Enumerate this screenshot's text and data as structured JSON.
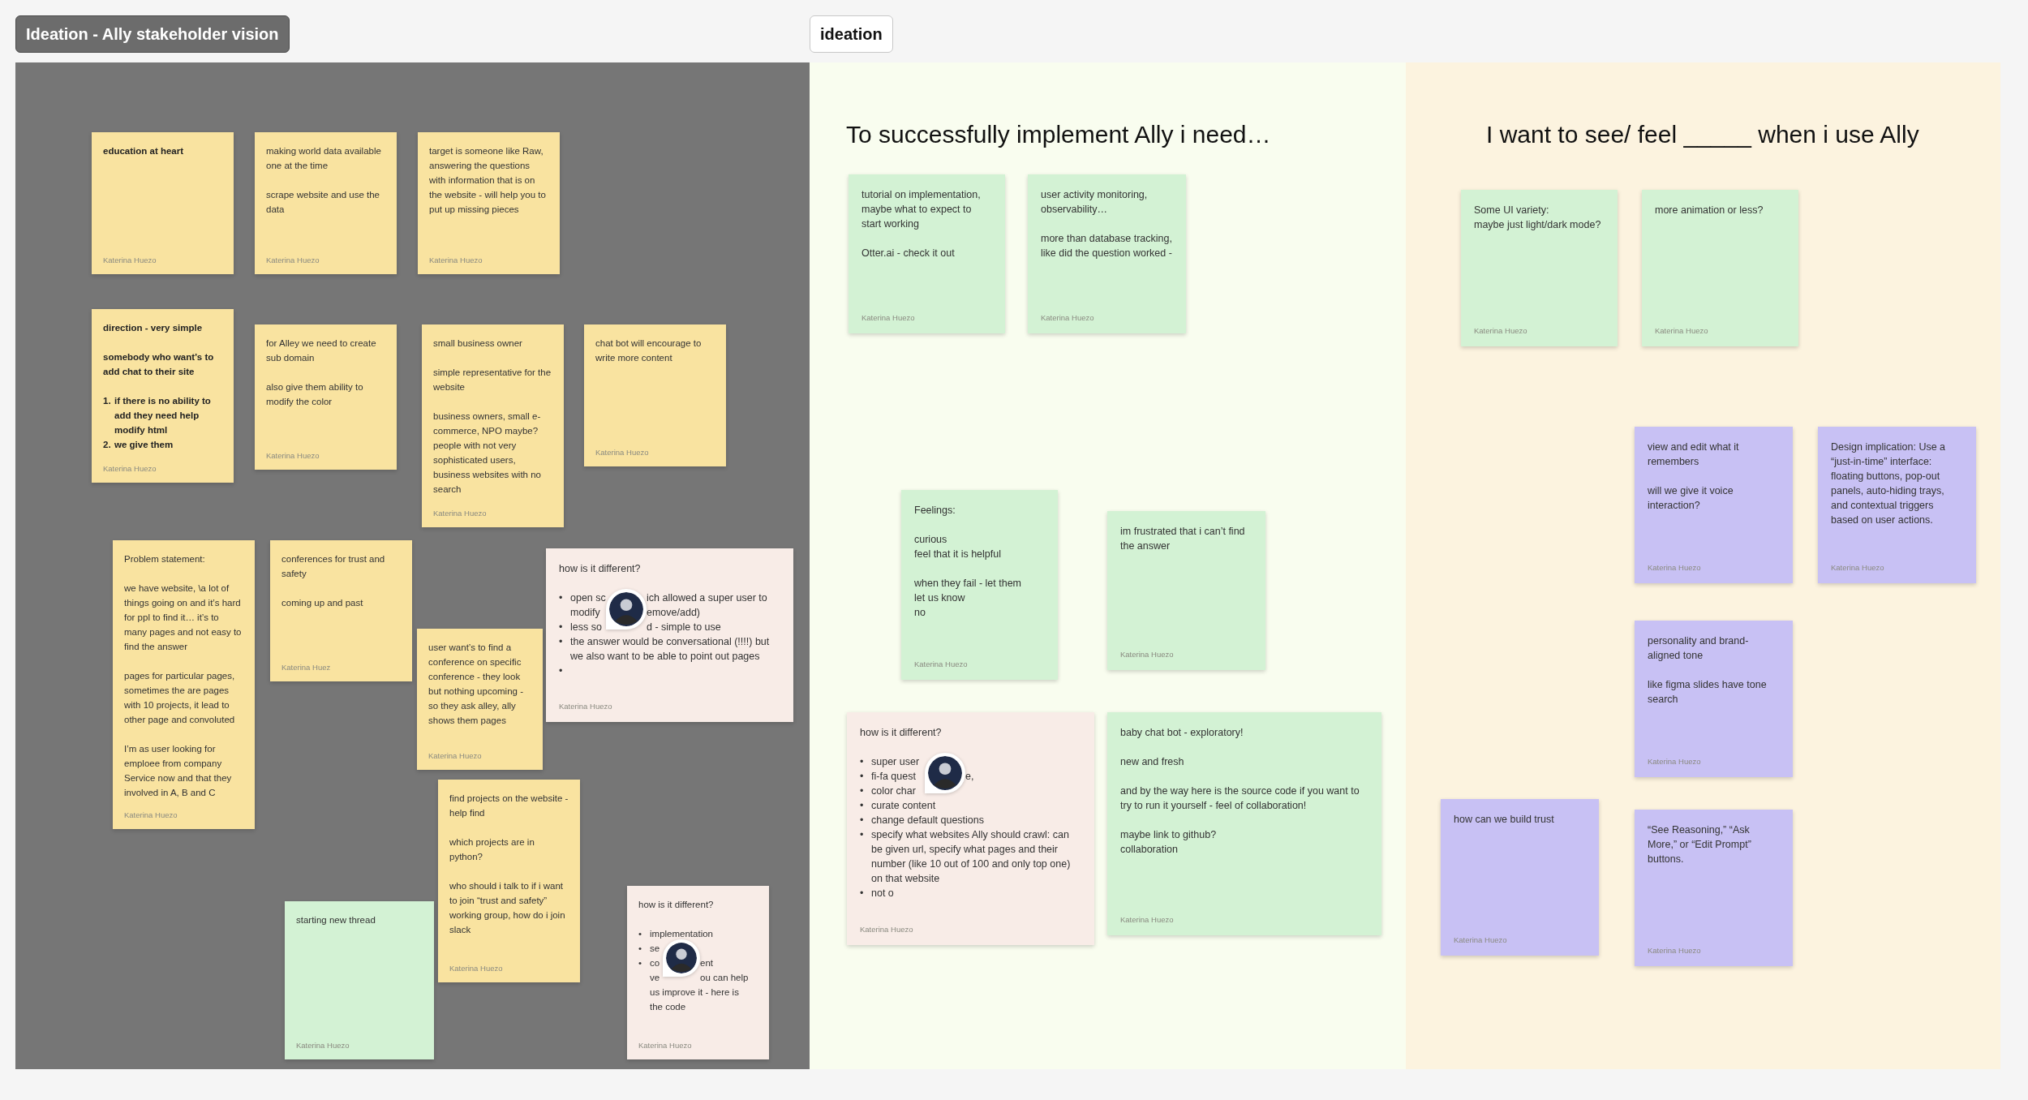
{
  "sections": [
    {
      "label": "Ideation - Ally stakeholder vision",
      "color": "#767676",
      "notes": [
        {
          "color": "#f9e3a0",
          "bold": true,
          "blocks": [
            {
              "text": "education at heart"
            }
          ],
          "author": "Katerina Huezo"
        },
        {
          "color": "#f9e3a0",
          "blocks": [
            {
              "text": "making world data available one at the time"
            },
            {
              "text": "scrape website and use the data"
            }
          ],
          "author": "Katerina Huezo"
        },
        {
          "color": "#f9e3a0",
          "blocks": [
            {
              "text": "target is someone like Raw, answering the questions with information that is on the website - will help you to put up missing pieces"
            }
          ],
          "author": "Katerina Huezo"
        },
        {
          "color": "#f9e3a0",
          "bold": true,
          "blocks": [
            {
              "text": "direction - very simple"
            },
            {
              "text": "somebody who want’s to add chat to their site"
            },
            {
              "marker": "1.",
              "text": "if there is no ability to add they need help modify html"
            },
            {
              "marker": "2.",
              "text": "we give them"
            }
          ],
          "author": "Katerina Huezo"
        },
        {
          "color": "#f9e3a0",
          "blocks": [
            {
              "text": "for Alley we need to create sub domain"
            },
            {
              "text": "also give them ability to modify the color"
            }
          ],
          "author": "Katerina Huezo"
        },
        {
          "color": "#f9e3a0",
          "blocks": [
            {
              "text": "small business owner"
            },
            {
              "text": "simple representative for the website"
            },
            {
              "text": "business owners, small e-commerce, NPO maybe? people with not very sophisticated users, business websites with no search"
            }
          ],
          "author": "Katerina Huezo"
        },
        {
          "color": "#f9e3a0",
          "blocks": [
            {
              "text": "chat bot will encourage to write more content"
            }
          ],
          "author": "Katerina Huezo"
        },
        {
          "color": "#f9e3a0",
          "blocks": [
            {
              "text": "Problem statement:"
            },
            {
              "text": "we have website, \\a lot of things going on and it’s hard for ppl to find it… it’s to many pages and not easy to find the answer"
            },
            {
              "text": "pages for particular pages, sometimes the are pages with 10 projects, it lead to other page and convoluted"
            },
            {
              "text": "I’m as user looking for emploee from company Service now and that they involved in A, B and C"
            }
          ],
          "author": "Katerina Huezo"
        },
        {
          "color": "#f9e3a0",
          "blocks": [
            {
              "text": "conferences for trust and safety"
            },
            {
              "text": "coming up and past"
            }
          ],
          "author": "Katerina Huez"
        },
        {
          "color": "#f9e3a0",
          "blocks": [
            {
              "text": "user want’s to find a conference on specific conference - they look but nothing upcoming - so they ask alley, ally shows them pages"
            }
          ],
          "author": "Katerina Huezo"
        },
        {
          "color": "#f9e3a0",
          "blocks": [
            {
              "text": "find projects on the website - help find"
            },
            {
              "text": "which projects are in python?"
            },
            {
              "text": "who should i talk to if i want to join “trust and safety” working group, how do i join slack"
            }
          ],
          "author": "Katerina Huezo"
        },
        {
          "color": "#f8ece7",
          "blocks": [
            {
              "text": "how is it different?"
            },
            {
              "marker": "•",
              "covered": true,
              "avatar": true,
              "text": "open sc",
              "after": "ich allowed a super user to"
            },
            {
              "covered": true,
              "text": "modify",
              "after": "emove/add)"
            },
            {
              "marker": "•",
              "covered": true,
              "text": "less so",
              "after": "d - simple to use"
            },
            {
              "marker": "•",
              "covered": false,
              "text": "the answer would be conversational (!!!!) but we also want to be able to point out pages"
            },
            {
              "marker": "•"
            }
          ],
          "author": "Katerina Huezo"
        },
        {
          "color": "#d3f2d4",
          "blocks": [
            {
              "text": "starting new thread"
            }
          ],
          "author": "Katerina Huezo"
        },
        {
          "color": "#f8ece7",
          "blocks": [
            {
              "text": "how is it different?"
            },
            {
              "marker": "•",
              "covered": false,
              "text": "implementation"
            },
            {
              "marker": "•",
              "covered": true,
              "avatar": true,
              "text": "se"
            },
            {
              "marker": "•",
              "covered": true,
              "text": "co",
              "after": "ent"
            },
            {
              "covered": true,
              "text": "ve",
              "after": "ou can help"
            },
            {
              "covered": false,
              "text": "us improve it - here is"
            },
            {
              "covered": false,
              "text": "the code"
            }
          ],
          "author": "Katerina Huezo"
        }
      ]
    },
    {
      "label": "ideation",
      "color": "#f9fdef",
      "heading": "To successfully implement Ally i need…",
      "notes": [
        {
          "color": "#d3f2d4",
          "blocks": [
            {
              "text": "tutorial on implementation, maybe what to expect to start working"
            },
            {
              "text": "Otter.ai - check it out"
            }
          ],
          "author": "Katerina Huezo"
        },
        {
          "color": "#d3f2d4",
          "blocks": [
            {
              "text": "user activity monitoring, observability…"
            },
            {
              "text": "more than database tracking, like did the question worked -"
            }
          ],
          "author": "Katerina Huezo"
        },
        {
          "color": "#d3f2d4",
          "blocks": [
            {
              "text": "Feelings:"
            },
            {
              "text": "curious\nfeel that it is helpful"
            },
            {
              "text": "when they fail - let them\nlet us know\nno"
            }
          ],
          "author": "Katerina Huezo"
        },
        {
          "color": "#d3f2d4",
          "blocks": [
            {
              "text": "im frustrated that i can’t find the answer"
            }
          ],
          "author": "Katerina Huezo"
        },
        {
          "color": "#f8ece7",
          "blocks": [
            {
              "text": "how is it different?"
            },
            {
              "marker": "•",
              "covered": true,
              "avatar": true,
              "text": "super user"
            },
            {
              "marker": "•",
              "covered": true,
              "text": "fi-fa quest",
              "after": "e,"
            },
            {
              "marker": "•",
              "covered": true,
              "text": "color char"
            },
            {
              "marker": "•",
              "covered": false,
              "text": "curate content"
            },
            {
              "marker": "•",
              "covered": false,
              "text": "change default questions"
            },
            {
              "marker": "•",
              "covered": false,
              "text": "specify what websites Ally should crawl: can be given url, specify what pages and their number (like 10 out of 100 and only top one) on that website"
            },
            {
              "marker": "•",
              "covered": false,
              "text": "not o"
            }
          ],
          "author": "Katerina Huezo"
        },
        {
          "color": "#d3f2d4",
          "blocks": [
            {
              "text": "baby chat bot - exploratory!"
            },
            {
              "text": "new and fresh"
            },
            {
              "text": "and by the way here is the source code if you want to try to run it yourself - feel of collaboration!"
            },
            {
              "text": "maybe link to github?\ncollaboration"
            }
          ],
          "author": "Katerina Huezo"
        }
      ]
    },
    {
      "color": "#fcf3df",
      "heading": "I want to see/ feel _____ when i use Ally",
      "notes": [
        {
          "color": "#d3f2d4",
          "blocks": [
            {
              "text": "Some UI variety:\nmaybe just light/dark mode?"
            }
          ],
          "author": "Katerina Huezo"
        },
        {
          "color": "#d3f2d4",
          "blocks": [
            {
              "text": "more animation or less?"
            }
          ],
          "author": "Katerina Huezo"
        },
        {
          "color": "#c8c1f4",
          "blocks": [
            {
              "text": "view and edit what it remembers"
            },
            {
              "text": "will we give it voice interaction?"
            }
          ],
          "author": "Katerina Huezo"
        },
        {
          "color": "#c8c1f4",
          "blocks": [
            {
              "text": "Design implication: Use a “just-in-time” interface: floating buttons, pop-out panels, auto-hiding trays, and contextual triggers based on user actions."
            }
          ],
          "author": "Katerina Huezo"
        },
        {
          "color": "#c8c1f4",
          "blocks": [
            {
              "text": "personality and brand-aligned tone"
            },
            {
              "text": "like figma slides have tone search"
            }
          ],
          "author": "Katerina Huezo"
        },
        {
          "color": "#c8c1f4",
          "blocks": [
            {
              "text": "how can we build trust"
            }
          ],
          "author": "Katerina Huezo"
        },
        {
          "color": "#c8c1f4",
          "blocks": [
            {
              "text": "“See Reasoning,” “Ask More,” or “Edit Prompt” buttons."
            }
          ],
          "author": "Katerina Huezo"
        }
      ]
    }
  ]
}
